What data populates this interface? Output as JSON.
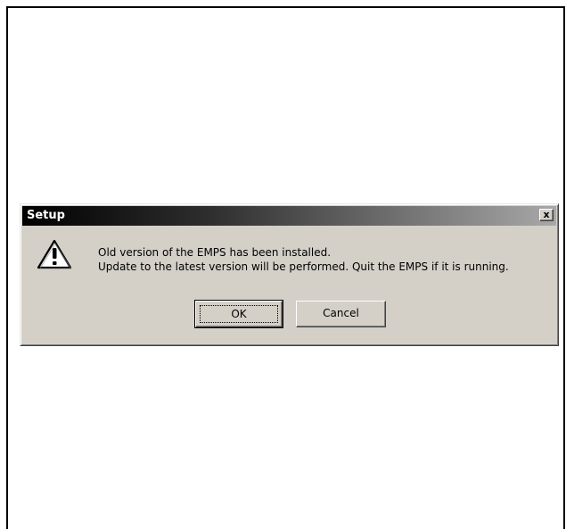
{
  "dialog": {
    "title": "Setup",
    "close_label": "x",
    "icon": "warning-icon",
    "message_line1": "Old version of the EMPS has been installed.",
    "message_line2": "Update to the latest version will be performed. Quit the EMPS if it is running.",
    "ok_label": "OK",
    "cancel_label": "Cancel"
  },
  "colors": {
    "dialog_face": "#d4d0c8",
    "titlebar_start": "#000000",
    "titlebar_end": "#a8a8a8",
    "title_text": "#ffffff"
  }
}
